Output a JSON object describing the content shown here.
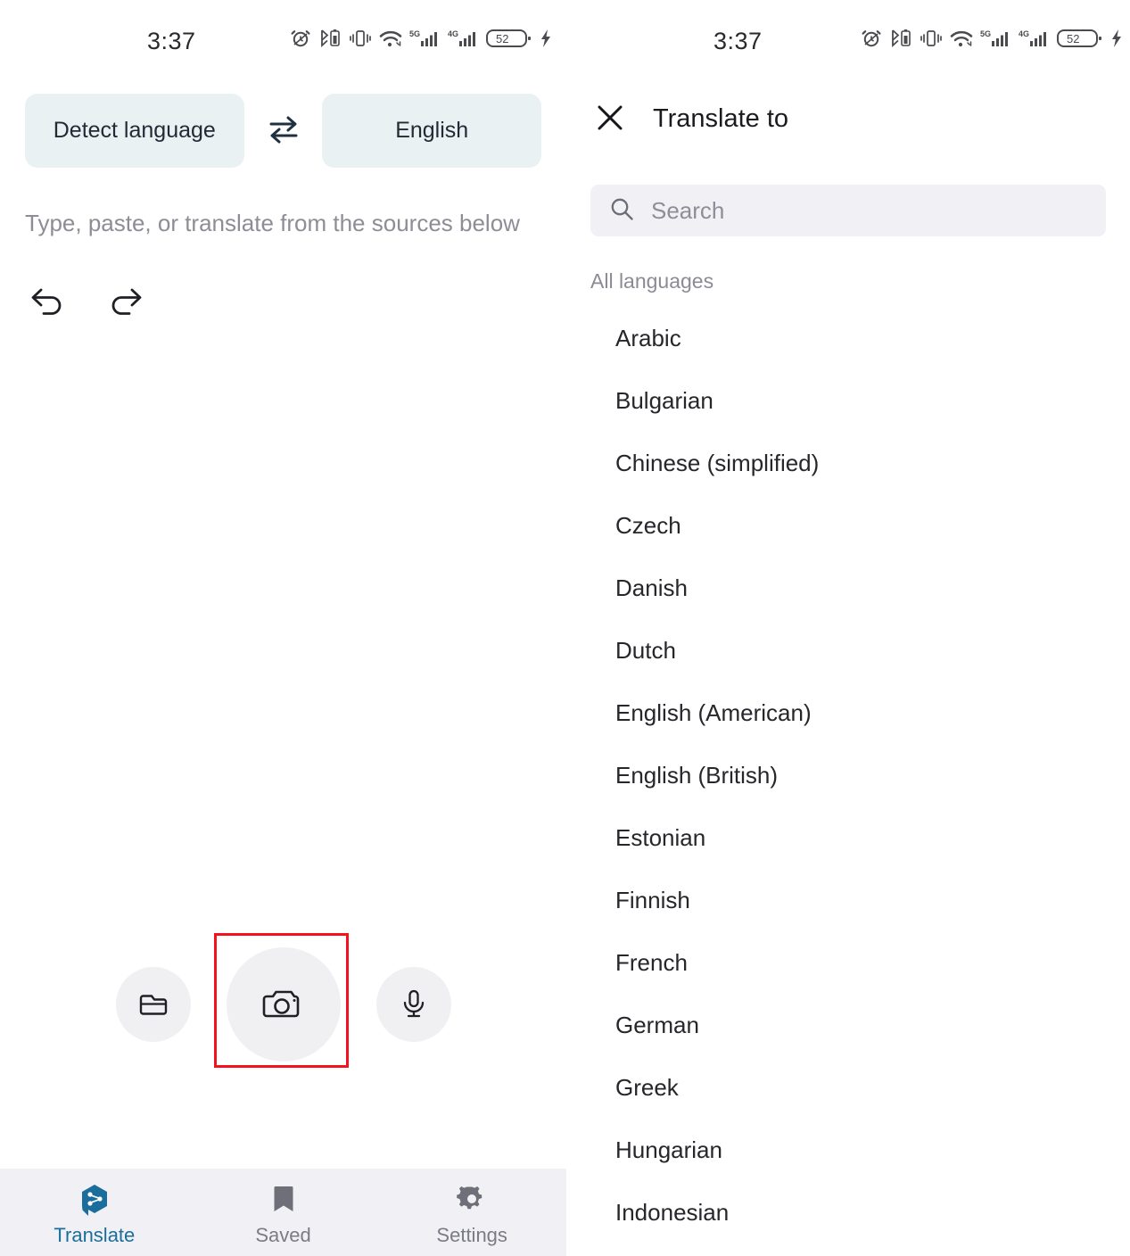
{
  "status_bar": {
    "time": "3:37",
    "battery_percent": "52",
    "network_5g": "5G",
    "network_4g": "4G",
    "icons": [
      "alarm-icon",
      "bluetooth-battery-icon",
      "vibrate-icon",
      "wifi-icon",
      "signal-5g-icon",
      "signal-4g-icon",
      "battery-icon",
      "charging-bolt-icon"
    ]
  },
  "translate_screen": {
    "source_language": "Detect language",
    "target_language": "English",
    "swap_icon": "swap-horizontal-icon",
    "input_placeholder": "Type, paste, or translate from the sources below",
    "undo_icon": "undo-icon",
    "redo_icon": "redo-icon",
    "actions": {
      "folder_label": "folder-icon",
      "camera_label": "camera-icon",
      "mic_label": "microphone-icon"
    },
    "highlight_color": "#f6121d",
    "bottom_nav": [
      {
        "label": "Translate",
        "icon": "translate-icon",
        "active": true
      },
      {
        "label": "Saved",
        "icon": "bookmark-icon",
        "active": false
      },
      {
        "label": "Settings",
        "icon": "gear-icon",
        "active": false
      }
    ],
    "accent_color": "#1b6e9c",
    "chip_background": "#eaf1f3"
  },
  "language_sheet": {
    "title": "Translate to",
    "close_icon": "close-icon",
    "search_icon": "search-icon",
    "search_value": "",
    "search_placeholder": "Search",
    "section_header": "All languages",
    "languages": [
      "Arabic",
      "Bulgarian",
      "Chinese (simplified)",
      "Czech",
      "Danish",
      "Dutch",
      "English (American)",
      "English (British)",
      "Estonian",
      "Finnish",
      "French",
      "German",
      "Greek",
      "Hungarian",
      "Indonesian"
    ]
  }
}
